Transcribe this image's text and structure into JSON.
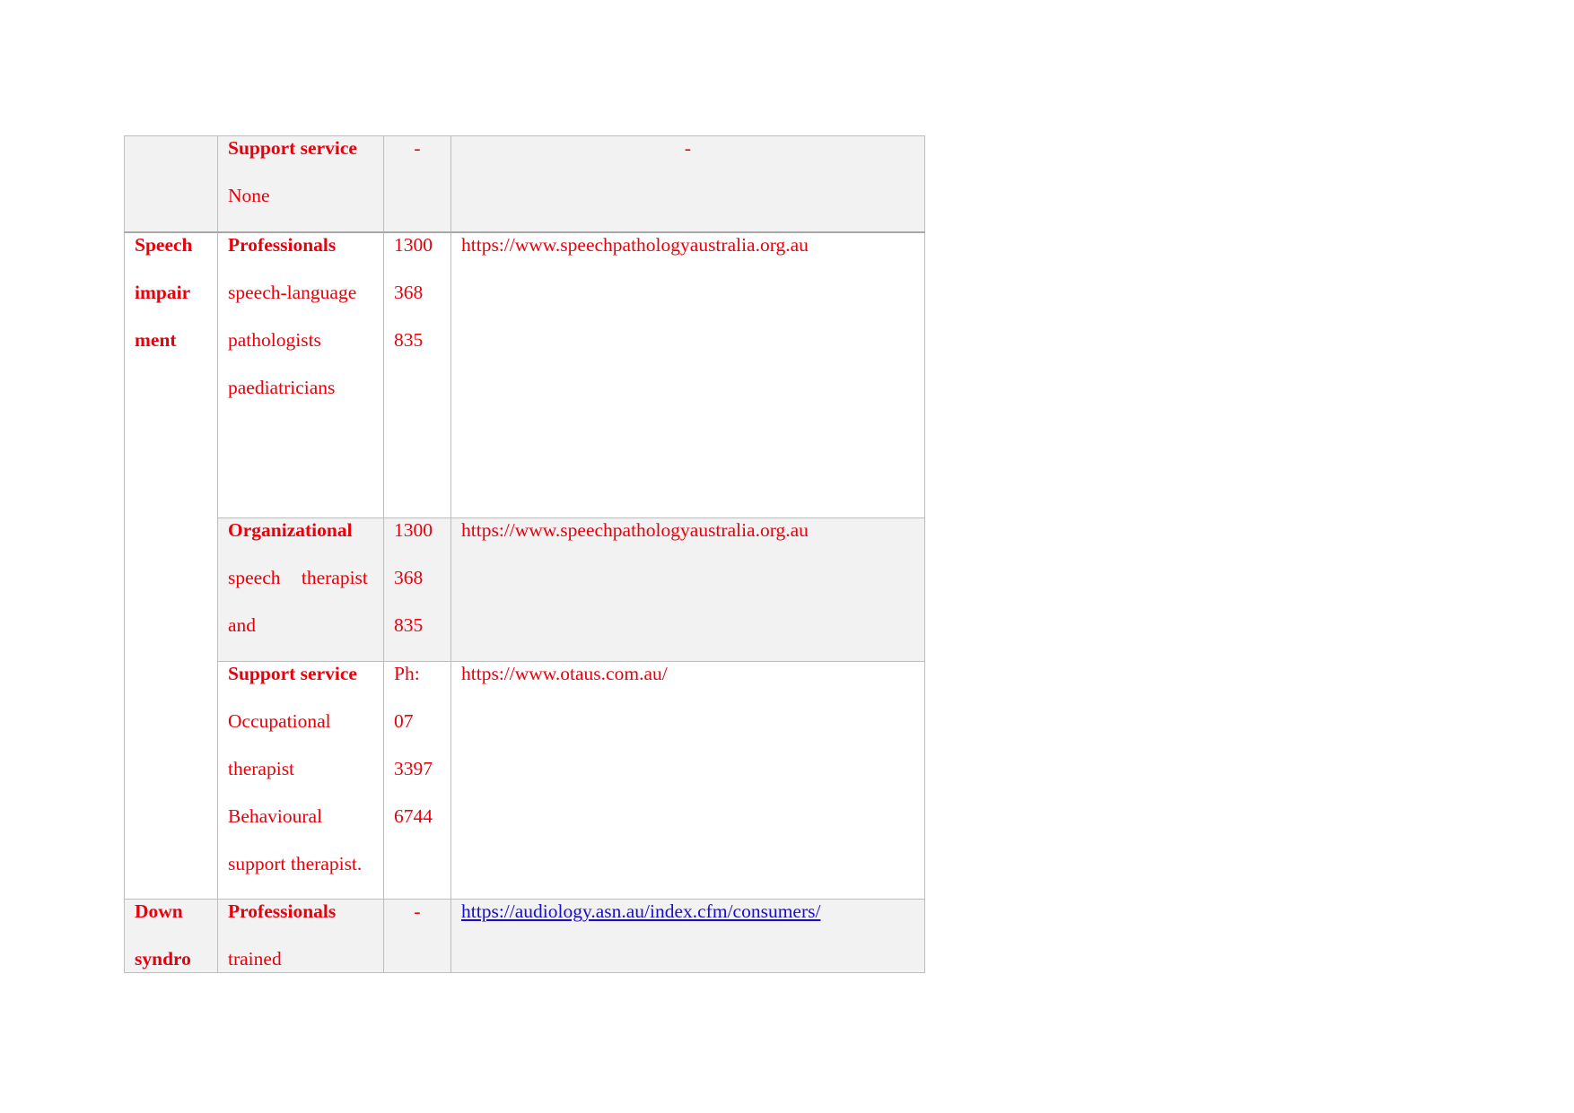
{
  "rows": [
    {
      "condition": [],
      "service_title": "Support service",
      "service_lines": [
        "None"
      ],
      "phone": [
        "-"
      ],
      "url": "-",
      "shaded": true
    },
    {
      "condition": [
        "Speech",
        "impair",
        "ment"
      ],
      "service_title": "Professionals",
      "service_lines": [
        "speech-language",
        "pathologists",
        "paediatricians"
      ],
      "phone": [
        "1300",
        "368",
        "835"
      ],
      "url": "https://www.speechpathologyaustralia.org.au",
      "shaded": false
    },
    {
      "service_title": "Organizational",
      "service_lines": [
        "speech therapist",
        "and"
      ],
      "phone": [
        "1300",
        "368",
        "835"
      ],
      "url": "https://www.speechpathologyaustralia.org.au",
      "shaded": true
    },
    {
      "service_title": "Support service",
      "service_lines": [
        "Occupational",
        "therapist",
        "Behavioural",
        "support therapist."
      ],
      "phone": [
        "Ph:",
        "07",
        "3397",
        "6744"
      ],
      "url": "https://www.otaus.com.au/",
      "shaded": false
    },
    {
      "condition": [
        "Down",
        "syndro"
      ],
      "service_title": "Professionals",
      "service_lines": [
        "trained"
      ],
      "phone": [
        "-"
      ],
      "url": "https://audiology.asn.au/index.cfm/consumers/",
      "url_is_link": true,
      "shaded": true
    }
  ],
  "colors": {
    "text": "#e8000b",
    "link": "#1a0dcc",
    "shade": "#f2f2f2"
  }
}
